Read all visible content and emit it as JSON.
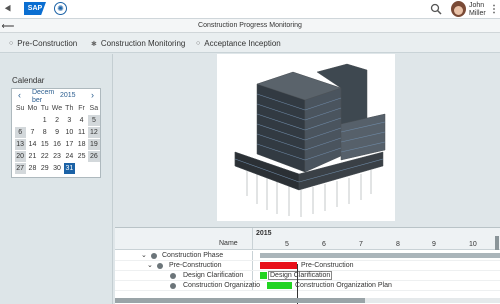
{
  "header": {
    "logo": "SAP",
    "user_name_first": "John",
    "user_name_last": "Miller",
    "icons": [
      "back-arrow",
      "globe-icon",
      "search-icon",
      "more-icon"
    ]
  },
  "subheader": {
    "title": "Construction Progress Monitoring"
  },
  "tabs": [
    {
      "label": "Pre-Construction",
      "marker": "○",
      "active": false
    },
    {
      "label": "Construction Monitoring",
      "marker": "✱",
      "active": true
    },
    {
      "label": "Acceptance Inception",
      "marker": "○",
      "active": false
    }
  ],
  "calendar": {
    "section_label": "Calendar",
    "month_top": "Decem",
    "month_bottom": "ber",
    "year": "2015",
    "prev": "‹",
    "next": "›",
    "weekdays": [
      "Su",
      "Mo",
      "Tu",
      "We",
      "Th",
      "Fr",
      "Sa"
    ],
    "selected_day": "31",
    "colors": {
      "selected": "#1b62a6",
      "weekend": "#d3d8db"
    }
  },
  "gantt": {
    "year": "2015",
    "name_header": "Name",
    "columns": [
      "5",
      "6",
      "7",
      "8",
      "9",
      "10"
    ],
    "rows": [
      {
        "label": "Construction Phase",
        "bar_label": "",
        "bar_color": "#aab5ba"
      },
      {
        "label": "Pre-Construction",
        "bar_label": "Pre-Construction",
        "bar_color": "#e8101a"
      },
      {
        "label": "Design Clarification",
        "bar_label": "Design Clarification",
        "bar_color": "#22d422"
      },
      {
        "label": "Construction Organizatio",
        "bar_label": "Construction Organization Plan",
        "bar_color": "#22d422"
      }
    ]
  }
}
